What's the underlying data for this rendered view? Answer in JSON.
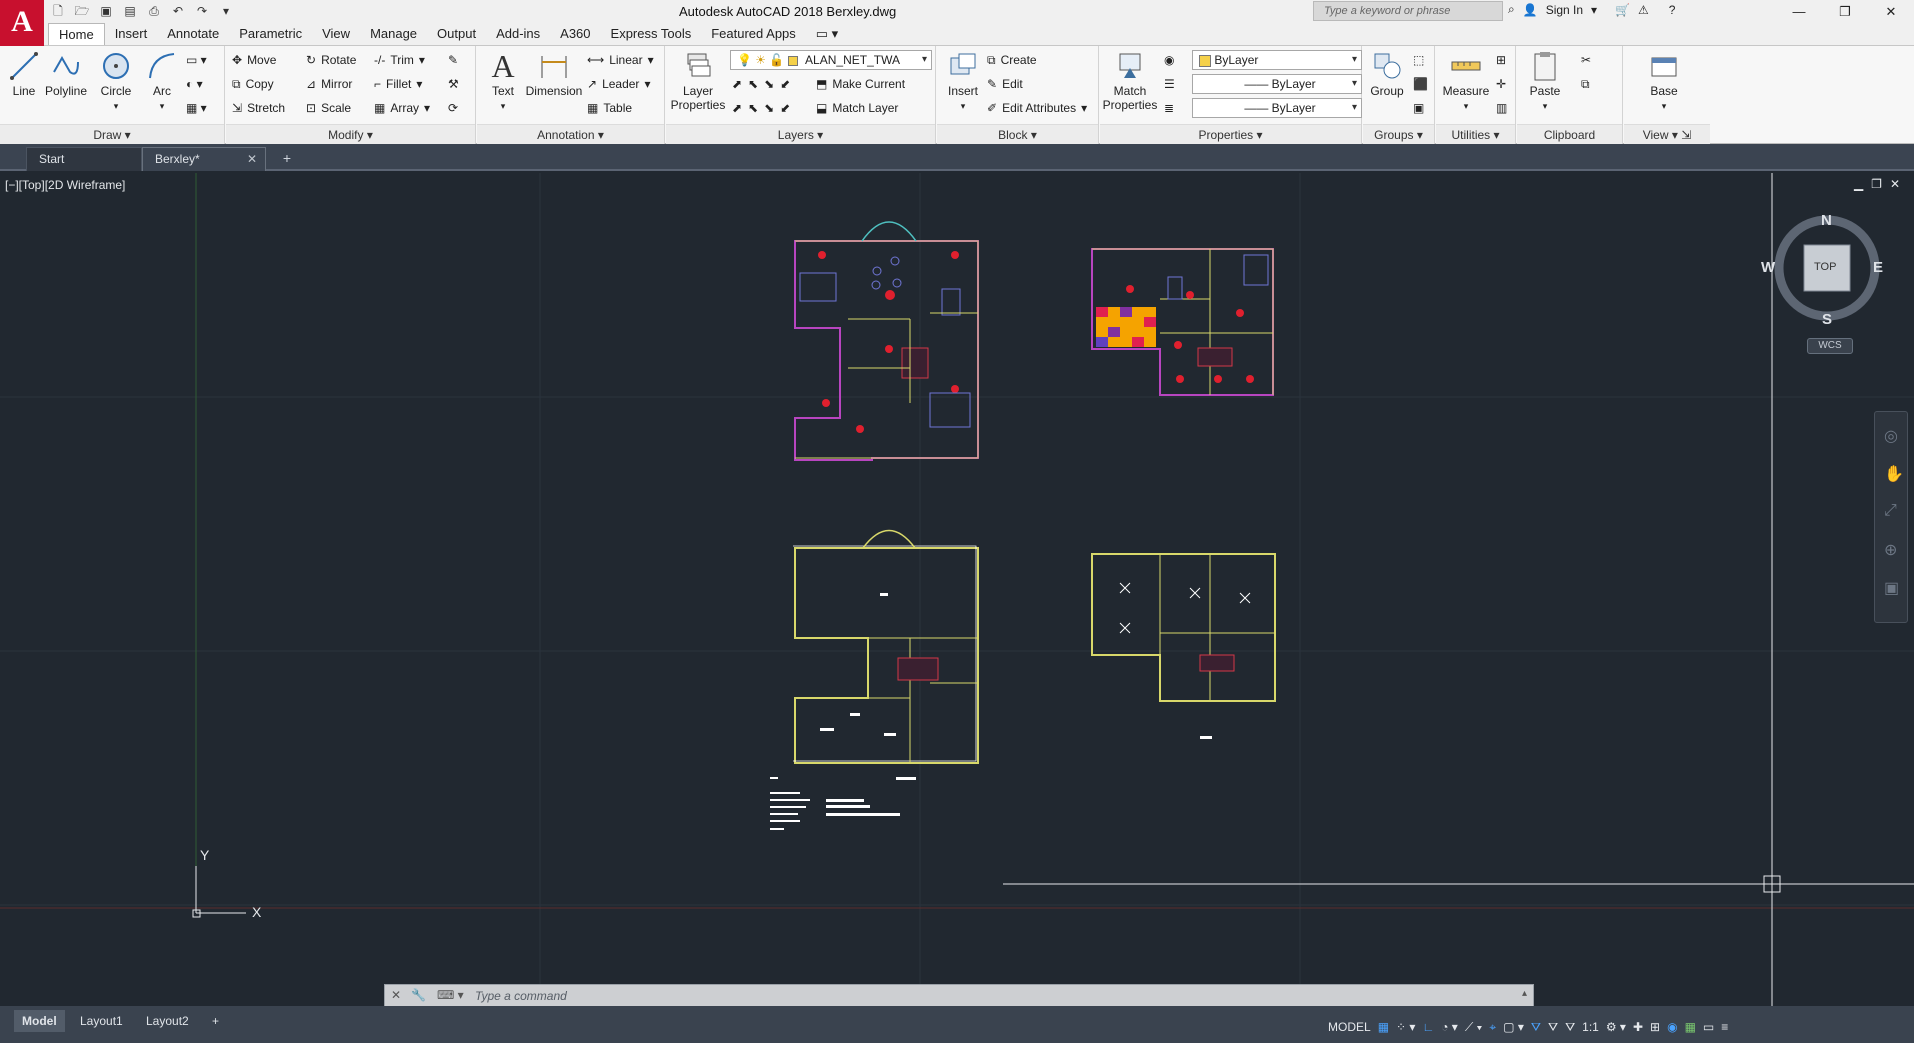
{
  "app": {
    "logo": "A",
    "title": "Autodesk AutoCAD 2018    Berxley.dwg",
    "search_placeholder": "Type a keyword or phrase",
    "sign_in": "Sign In"
  },
  "ribbon_tabs": [
    "Home",
    "Insert",
    "Annotate",
    "Parametric",
    "View",
    "Manage",
    "Output",
    "Add-ins",
    "A360",
    "Express Tools",
    "Featured Apps"
  ],
  "panels": {
    "draw": {
      "title": "Draw",
      "line": "Line",
      "polyline": "Polyline",
      "circle": "Circle",
      "arc": "Arc"
    },
    "modify": {
      "title": "Modify",
      "move": "Move",
      "rotate": "Rotate",
      "trim": "Trim",
      "copy": "Copy",
      "mirror": "Mirror",
      "fillet": "Fillet",
      "stretch": "Stretch",
      "scale": "Scale",
      "array": "Array"
    },
    "annotation": {
      "title": "Annotation",
      "text": "Text",
      "dimension": "Dimension",
      "linear": "Linear",
      "leader": "Leader",
      "table": "Table"
    },
    "layers": {
      "title": "Layers",
      "layer_properties_1": "Layer",
      "layer_properties_2": "Properties",
      "current_layer": "ALAN_NET_TWA",
      "make_current": "Make Current",
      "match_layer": "Match Layer"
    },
    "block": {
      "title": "Block",
      "insert": "Insert",
      "create": "Create",
      "edit": "Edit",
      "edit_attributes": "Edit Attributes"
    },
    "properties": {
      "title": "Properties",
      "match_1": "Match",
      "match_2": "Properties",
      "color": "ByLayer",
      "linetype": "ByLayer",
      "lineweight": "ByLayer"
    },
    "groups": {
      "title": "Groups",
      "group": "Group"
    },
    "utilities": {
      "title": "Utilities",
      "measure": "Measure"
    },
    "clipboard": {
      "title": "Clipboard",
      "paste": "Paste"
    },
    "view": {
      "title": "View",
      "base": "Base"
    }
  },
  "doc_tabs": {
    "start": "Start",
    "active": "Berxley*"
  },
  "viewport": {
    "label": "[−][Top][2D Wireframe]"
  },
  "viewcube": {
    "n": "N",
    "s": "S",
    "e": "E",
    "w": "W",
    "face": "TOP",
    "wcs": "WCS"
  },
  "ucs": {
    "x": "X",
    "y": "Y"
  },
  "command": {
    "placeholder": "Type a command"
  },
  "layout_tabs": [
    "Model",
    "Layout1",
    "Layout2"
  ],
  "status": {
    "model": "MODEL",
    "scale": "1:1"
  }
}
